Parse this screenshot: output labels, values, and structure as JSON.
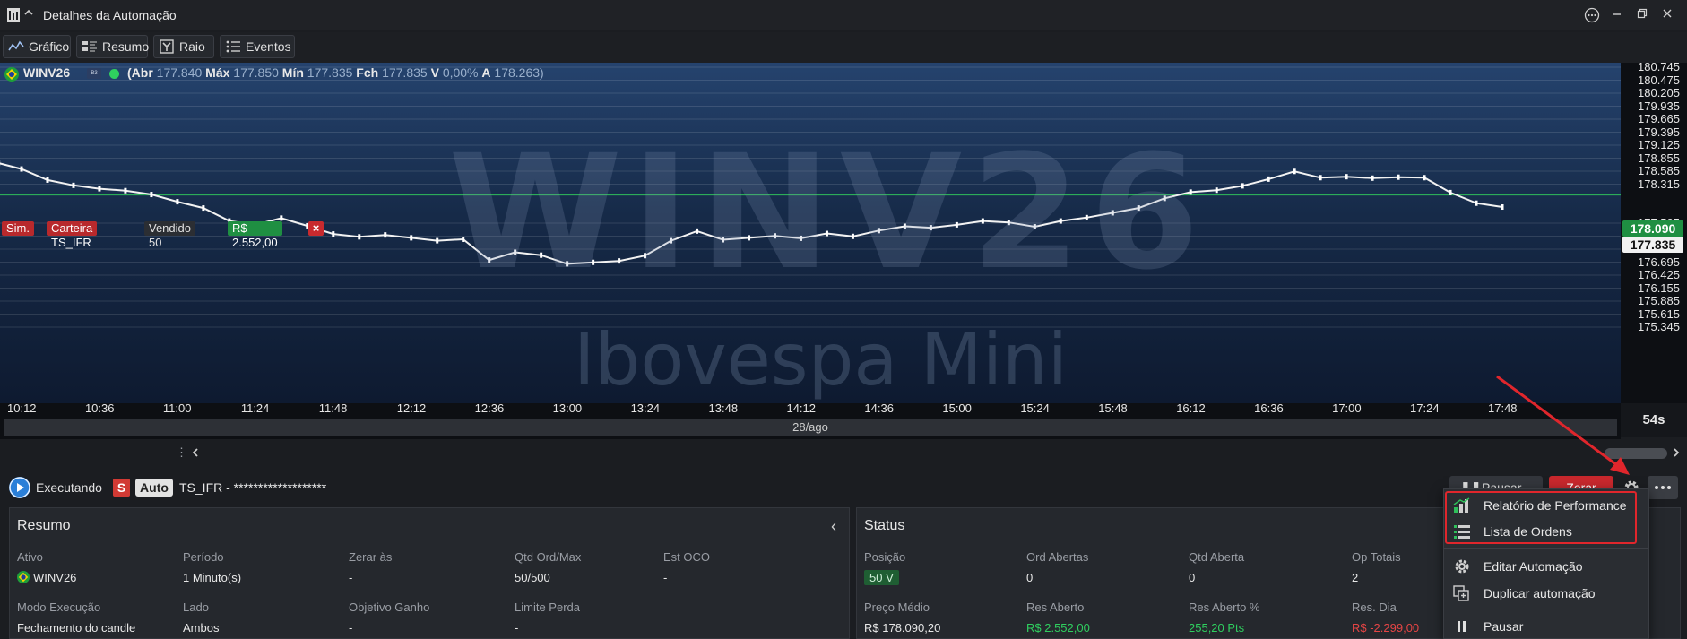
{
  "window": {
    "title": "Detalhes da Automação",
    "collapse_glyph": "^",
    "controls": [
      "more-options-icon",
      "minimize-icon",
      "restore-icon",
      "close-icon"
    ]
  },
  "tabs": [
    {
      "label": "Gráfico",
      "icon": "line-chart-icon"
    },
    {
      "label": "Resumo",
      "icon": "summary-list-icon"
    },
    {
      "label": "Raio X",
      "icon": "xray-icon"
    },
    {
      "label": "Eventos",
      "icon": "events-list-icon"
    }
  ],
  "chart": {
    "symbol": "WINV26",
    "ohlc": {
      "open_label": "(Abr",
      "open": "177.840",
      "high_label": "Máx",
      "high": "177.850",
      "low_label": "Mín",
      "low": "177.835",
      "close_label": "Fch",
      "close": "177.835",
      "var_label": "V",
      "var": "0,00%",
      "avg_label": "A",
      "avg": "178.263)"
    },
    "watermark_symbol": "WINV26",
    "watermark_name": "Ibovespa Mini",
    "order_line": {
      "sim": "Sim.",
      "wallet": "Carteira TS_IFR",
      "position": "Vendido 50",
      "pnl": "R$ 2.552,00",
      "close_glyph": "×"
    },
    "price_ticks": [
      "180.745",
      "180.475",
      "180.205",
      "179.935",
      "179.665",
      "179.395",
      "179.125",
      "178.855",
      "178.585",
      "178.315",
      "177.505",
      "177.235",
      "176.965",
      "176.695",
      "176.425",
      "176.155",
      "175.885",
      "175.615",
      "175.345"
    ],
    "avg_price_tag": "178.090",
    "last_price_tag": "177.835",
    "time_ticks": [
      "10:12",
      "10:36",
      "11:00",
      "11:24",
      "11:48",
      "12:12",
      "12:36",
      "13:00",
      "13:24",
      "13:48",
      "14:12",
      "14:36",
      "15:00",
      "15:24",
      "15:48",
      "16:12",
      "16:36",
      "17:00",
      "17:24",
      "17:48"
    ],
    "date": "28/ago",
    "timer": "54s",
    "colors": {
      "up": "#2fbf5a",
      "down": "#e64545",
      "avg_line": "#2fbf5a"
    }
  },
  "chart_data": {
    "type": "line",
    "title": "",
    "x": [
      "10:05",
      "10:12",
      "10:20",
      "10:28",
      "10:36",
      "10:44",
      "10:52",
      "11:00",
      "11:08",
      "11:16",
      "11:24",
      "11:32",
      "11:40",
      "11:48",
      "11:56",
      "12:04",
      "12:12",
      "12:20",
      "12:28",
      "12:36",
      "12:44",
      "12:52",
      "13:00",
      "13:08",
      "13:16",
      "13:24",
      "13:32",
      "13:40",
      "13:48",
      "13:56",
      "14:04",
      "14:12",
      "14:20",
      "14:28",
      "14:36",
      "14:44",
      "14:52",
      "15:00",
      "15:08",
      "15:16",
      "15:24",
      "15:32",
      "15:40",
      "15:48",
      "15:56",
      "16:04",
      "16:12",
      "16:20",
      "16:28",
      "16:36",
      "16:44",
      "16:52",
      "17:00",
      "17:08",
      "17:16",
      "17:24",
      "17:32",
      "17:40",
      "17:48"
    ],
    "series": [
      {
        "values": [
          178.75,
          178.63,
          178.4,
          178.29,
          178.22,
          178.18,
          178.1,
          177.95,
          177.82,
          177.55,
          177.47,
          177.61,
          177.45,
          177.28,
          177.22,
          177.26,
          177.2,
          177.14,
          177.17,
          176.74,
          176.9,
          176.84,
          176.66,
          176.69,
          176.72,
          176.83,
          177.14,
          177.34,
          177.16,
          177.2,
          177.24,
          177.19,
          177.29,
          177.23,
          177.35,
          177.44,
          177.41,
          177.47,
          177.55,
          177.52,
          177.43,
          177.55,
          177.62,
          177.72,
          177.82,
          178.02,
          178.15,
          178.19,
          178.28,
          178.42,
          178.58,
          178.45,
          178.47,
          178.44,
          178.46,
          178.45,
          178.14,
          177.92,
          177.84
        ]
      }
    ],
    "ylim": [
      175.345,
      180.745
    ],
    "y_ticks": [
      180.745,
      180.475,
      180.205,
      179.935,
      179.665,
      179.395,
      179.125,
      178.855,
      178.585,
      178.315,
      177.505,
      177.235,
      176.965,
      176.695,
      176.425,
      176.155,
      175.885,
      175.615,
      175.345
    ],
    "reference_lines": [
      {
        "name": "Preço Médio",
        "value": 178.09
      }
    ],
    "last_value": 177.835,
    "grid": true,
    "legend": "none"
  },
  "automation": {
    "state": "Executando",
    "s_badge": "S",
    "auto_badge": "Auto",
    "name": "TS_IFR - *******************",
    "pause_label": "Pausar",
    "zero_label": "Zerar"
  },
  "resumo": {
    "title": "Resumo",
    "collapse_glyph": "‹",
    "fields": [
      {
        "label": "Ativo",
        "value": "WINV26"
      },
      {
        "label": "Período",
        "value": "1 Minuto(s)"
      },
      {
        "label": "Zerar às",
        "value": "-"
      },
      {
        "label": "Qtd Ord/Max",
        "value": "50/500"
      },
      {
        "label": "Est OCO",
        "value": "-"
      },
      {
        "label": "Modo Execução",
        "value": "Fechamento do candle"
      },
      {
        "label": "Lado",
        "value": "Ambos"
      },
      {
        "label": "Objetivo Ganho",
        "value": "-"
      },
      {
        "label": "Limite Perda",
        "value": "-"
      }
    ]
  },
  "status": {
    "title": "Status",
    "fields": [
      {
        "label": "Posição",
        "value": "50 V"
      },
      {
        "label": "Ord Abertas",
        "value": "0"
      },
      {
        "label": "Qtd Aberta",
        "value": "0"
      },
      {
        "label": "Op Totais",
        "value": "2"
      },
      {
        "label": "Preço Médio",
        "value": "R$ 178.090,20"
      },
      {
        "label": "Res Aberto",
        "value": "R$ 2.552,00"
      },
      {
        "label": "Res Aberto %",
        "value": "255,20 Pts"
      },
      {
        "label": "Res. Dia",
        "value": "R$ -2.299,00"
      }
    ]
  },
  "menu": {
    "items": [
      {
        "label": "Relatório de Performance",
        "icon": "performance-chart-icon"
      },
      {
        "label": "Lista de Ordens",
        "icon": "order-list-icon"
      },
      {
        "label": "Editar Automação",
        "icon": "gear-icon"
      },
      {
        "label": "Duplicar automação",
        "icon": "duplicate-icon"
      },
      {
        "label": "Pausar",
        "icon": "pause-icon"
      }
    ]
  }
}
